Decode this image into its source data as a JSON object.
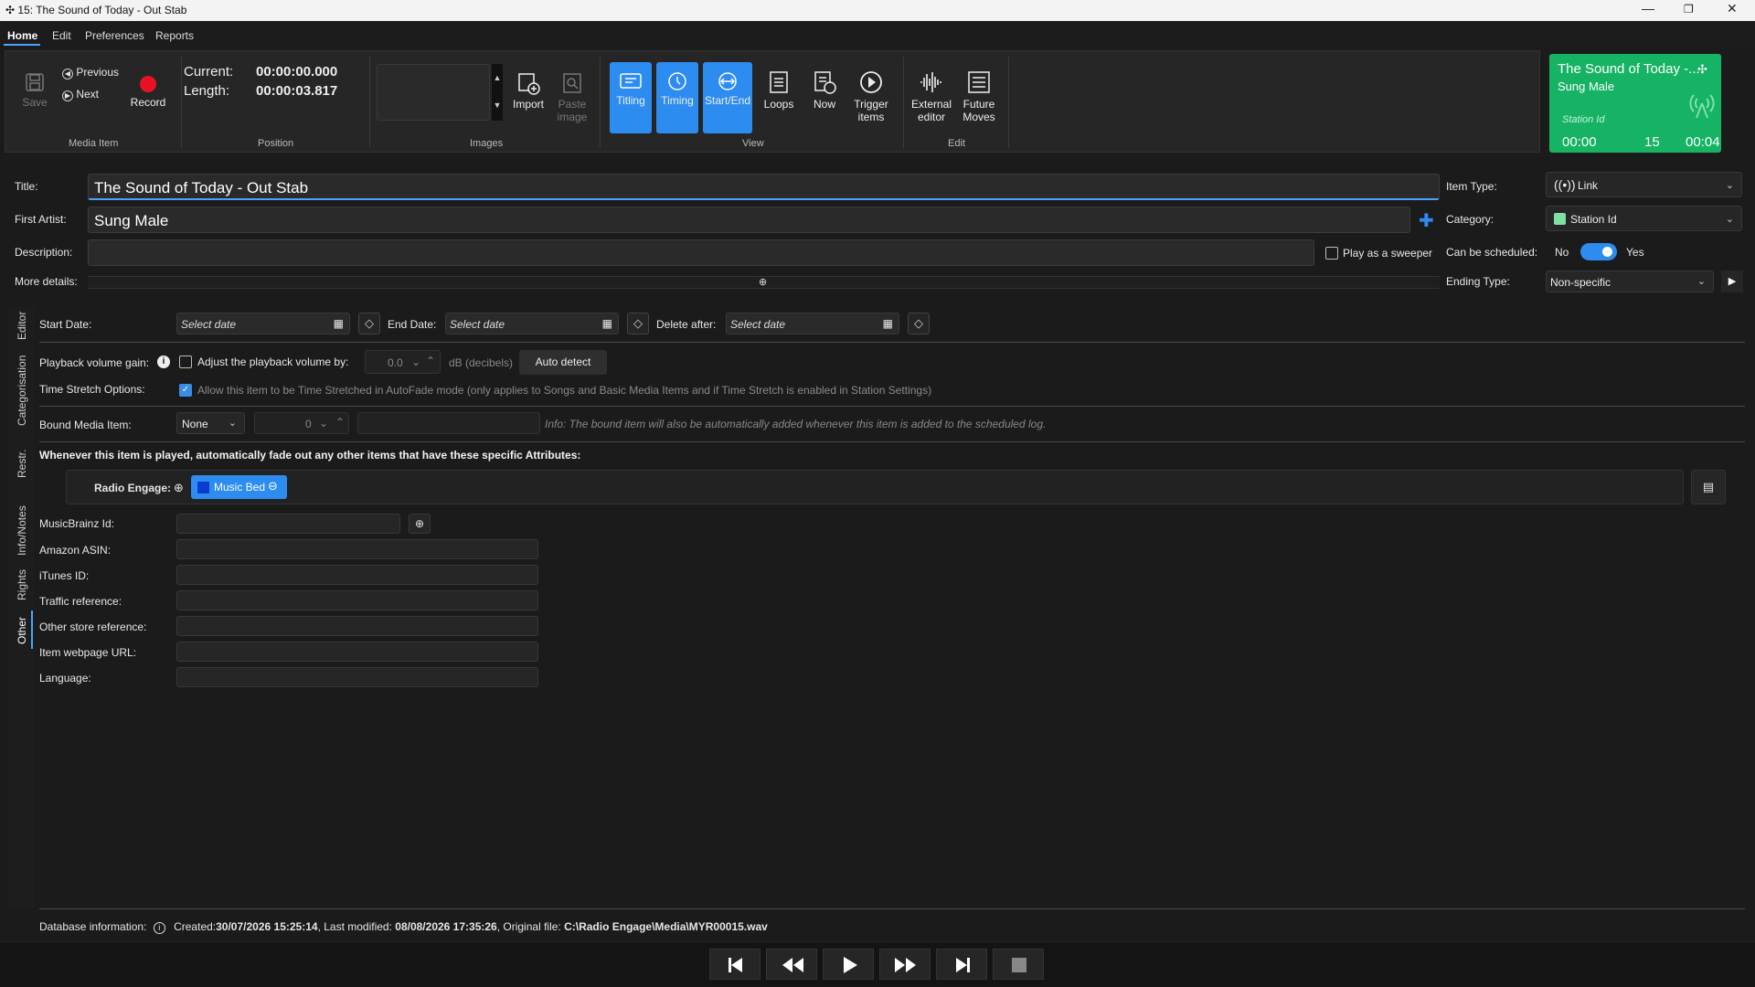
{
  "window": {
    "title": "15: The Sound of Today - Out Stab"
  },
  "menu": {
    "items": [
      "Home",
      "Edit",
      "Preferences",
      "Reports"
    ]
  },
  "ribbon": {
    "media_item": {
      "group": "Media Item",
      "save": "Save",
      "previous": "Previous",
      "next": "Next",
      "record": "Record"
    },
    "position": {
      "group": "Position",
      "current_label": "Current:",
      "current_value": "00:00:00.000",
      "length_label": "Length:",
      "length_value": "00:00:03.817"
    },
    "images": {
      "group": "Images",
      "import": "Import",
      "paste_line1": "Paste",
      "paste_line2": "image"
    },
    "view": {
      "group": "View",
      "titling": "Titling",
      "timing": "Timing",
      "start_end": "Start/End",
      "loops": "Loops",
      "now": "Now",
      "trigger_line1": "Trigger",
      "trigger_line2": "items"
    },
    "edit": {
      "group": "Edit",
      "external_line1": "External",
      "external_line2": "editor",
      "future_line1": "Future",
      "future_line2": "Moves"
    }
  },
  "now_card": {
    "title": "The Sound of Today -...",
    "artist": "Sung Male",
    "category": "Station Id",
    "time_start": "00:00",
    "number": "15",
    "time_end": "00:04",
    "color": "#16b364"
  },
  "form": {
    "title_label": "Title:",
    "title_value": "The Sound of Today - Out Stab",
    "artist_label": "First Artist:",
    "artist_value": "Sung Male",
    "description_label": "Description:",
    "description_value": "",
    "more_label": "More details:",
    "sweeper_label": "Play as a sweeper",
    "item_type_label": "Item Type:",
    "item_type_value": "Link",
    "category_label": "Category:",
    "category_value": "Station Id",
    "schedulable_label": "Can be scheduled:",
    "no": "No",
    "yes": "Yes",
    "ending_label": "Ending Type:",
    "ending_value": "Non-specific"
  },
  "side_tabs": [
    "Editor",
    "Categorisation",
    "Restr.",
    "Info/Notes",
    "Rights",
    "Other"
  ],
  "dates": {
    "start_label": "Start Date:",
    "end_label": "End Date:",
    "delete_label": "Delete after:",
    "placeholder": "Select date"
  },
  "playback": {
    "gain_label": "Playback volume gain:",
    "adjust_label": "Adjust the playback volume by:",
    "gain_value": "0.0",
    "unit": "dB (decibels)",
    "auto_detect": "Auto detect",
    "stretch_label": "Time Stretch Options:",
    "stretch_text": "Allow this item to be Time Stretched in AutoFade mode (only applies to Songs and Basic Media Items and if Time Stretch is enabled in Station Settings)"
  },
  "bound": {
    "label": "Bound Media Item:",
    "type_value": "None",
    "num_value": "0",
    "info": "Info: The bound item will also be automatically added whenever this item is added to the scheduled log."
  },
  "fade": {
    "heading": "Whenever this item is played, automatically fade out any other items that have these specific Attributes:",
    "group_label": "Radio Engage:",
    "tag": "Music Bed",
    "tag_color": "#0b3ccf"
  },
  "ids": [
    {
      "label": "MusicBrainz Id:",
      "value": ""
    },
    {
      "label": "Amazon ASIN:",
      "value": ""
    },
    {
      "label": "iTunes ID:",
      "value": ""
    },
    {
      "label": "Traffic reference:",
      "value": ""
    },
    {
      "label": "Other store reference:",
      "value": ""
    },
    {
      "label": "Item webpage URL:",
      "value": ""
    },
    {
      "label": "Language:",
      "value": ""
    }
  ],
  "footer": {
    "db_label": "Database information:",
    "created_label": "Created:",
    "created_value": "30/07/2026 15:25:14",
    "modified_label": ", Last modified: ",
    "modified_value": "08/08/2026 17:35:26",
    "file_label": ", Original file: ",
    "file_value": "C:\\Radio Engage\\Media\\MYR00015.wav"
  },
  "colors": {
    "accent": "#2d8cf0",
    "record": "#e81123",
    "nowplaying": "#16b364",
    "tag": "#0b3ccf"
  }
}
